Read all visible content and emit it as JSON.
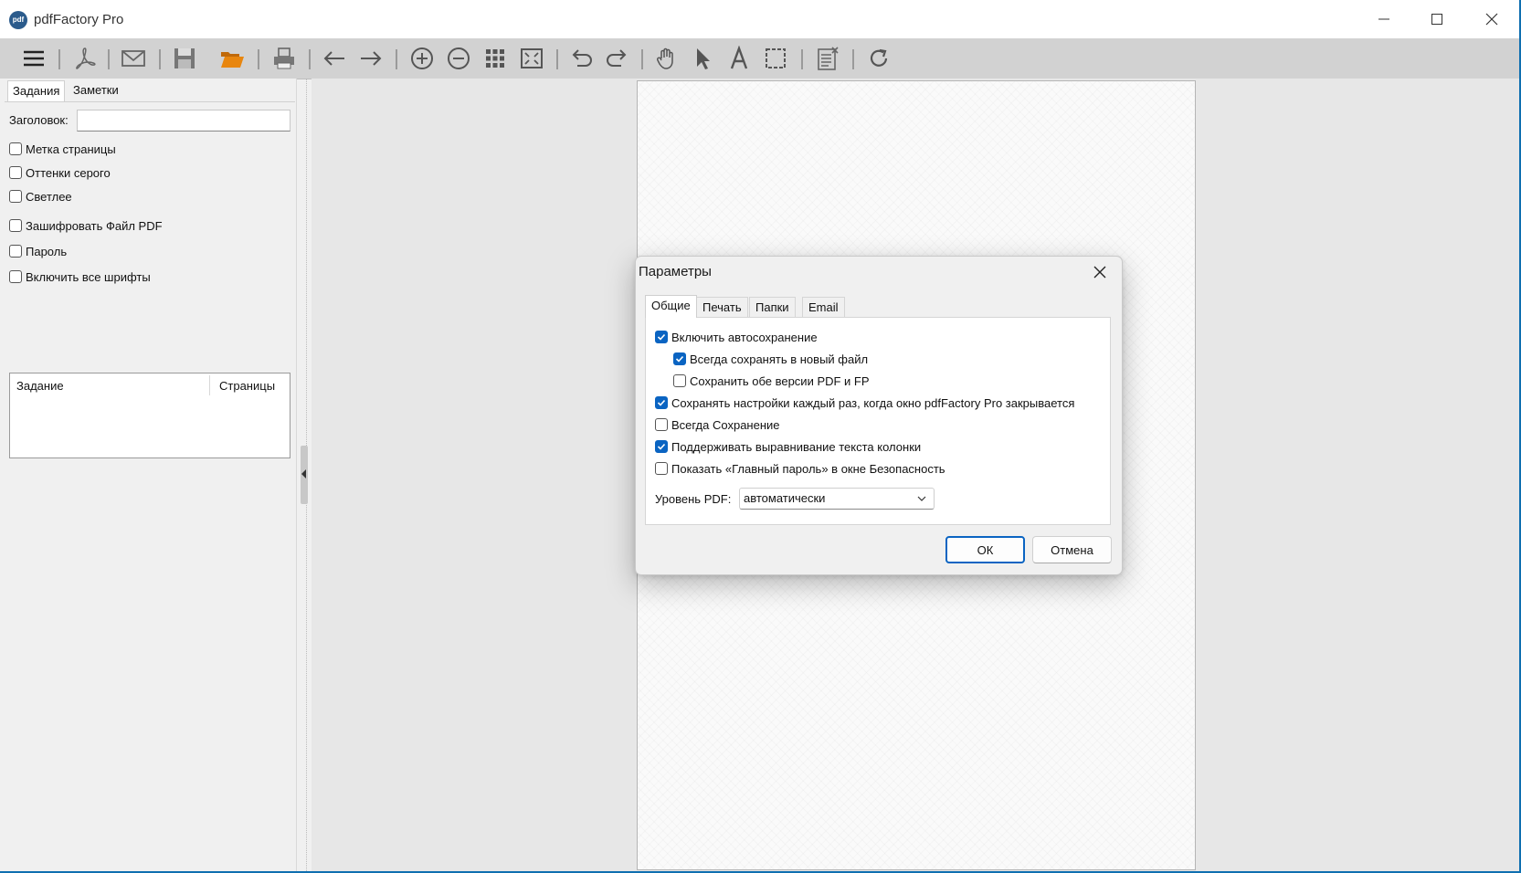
{
  "window": {
    "title": "pdfFactory Pro",
    "logo_text": "pdf"
  },
  "toolbar": {
    "icons": [
      "menu-icon",
      "pdf-acrobat-icon",
      "email-icon",
      "save-icon",
      "open-folder-icon",
      "print-icon",
      "back-arrow-icon",
      "forward-arrow-icon",
      "zoom-in-icon",
      "zoom-out-icon",
      "thumbnails-grid-icon",
      "fit-page-icon",
      "undo-icon",
      "redo-icon",
      "hand-tool-icon",
      "select-pointer-icon",
      "text-tool-icon",
      "selection-rect-icon",
      "delete-page-icon",
      "refresh-icon"
    ],
    "accent": "#e8860f"
  },
  "left_panel": {
    "tabs": [
      "Задания",
      "Заметки"
    ],
    "title_label": "Заголовок:",
    "title_value": "",
    "checkboxes": [
      {
        "label": "Метка страницы",
        "checked": false
      },
      {
        "label": "Оттенки серого",
        "checked": false
      },
      {
        "label": "Светлее",
        "checked": false
      },
      {
        "label": "Зашифровать Файл PDF",
        "checked": false
      },
      {
        "label": "Пароль",
        "checked": false
      },
      {
        "label": "Включить все шрифты",
        "checked": false
      }
    ],
    "job_list": {
      "col_job": "Задание",
      "col_pages": "Страницы"
    }
  },
  "dialog": {
    "title": "Параметры",
    "tabs": [
      "Общие",
      "Печать",
      "Папки",
      "Email"
    ],
    "active_tab": "Общие",
    "options": [
      {
        "label": "Включить автосохранение",
        "checked": true
      },
      {
        "label": "Всегда сохранять в новый файл",
        "checked": true
      },
      {
        "label": "Сохранить обе версии PDF и FP",
        "checked": false
      },
      {
        "label": "Сохранять настройки каждый раз, когда окно pdfFactory Pro закрывается",
        "checked": true
      },
      {
        "label": "Всегда Сохранение",
        "checked": false
      },
      {
        "label": "Поддерживать выравнивание текста колонки",
        "checked": true
      },
      {
        "label": "Показать «Главный пароль» в окне Безопасность",
        "checked": false
      }
    ],
    "pdf_level_label": "Уровень PDF:",
    "pdf_level_value": "автоматически",
    "ok_label": "ОК",
    "cancel_label": "Отмена",
    "accent": "#0a64c2"
  }
}
